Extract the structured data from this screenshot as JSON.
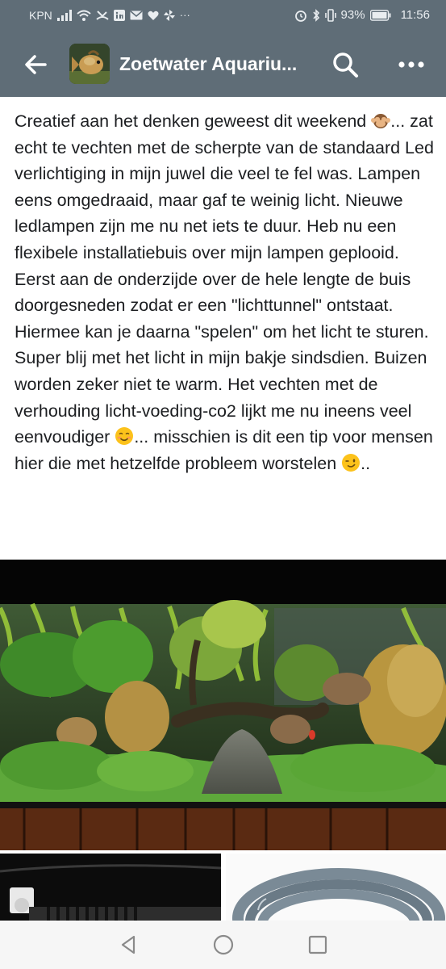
{
  "status_bar": {
    "carrier": "KPN",
    "battery": "93%",
    "time": "11:56",
    "left_icons": [
      "signal-icon",
      "wifi-icon",
      "missed-call-icon",
      "linkedin-icon",
      "mail-icon",
      "heart-icon",
      "pinwheel-icon",
      "more-notifications-icon"
    ],
    "right_icons": [
      "alarm-icon",
      "bluetooth-icon",
      "vibrate-icon",
      "battery-icon"
    ]
  },
  "app_bar": {
    "title": "Zoetwater Aquariu...",
    "bg_color": "#5f6d77",
    "icons": [
      "back-arrow-icon",
      "search-icon",
      "more-icon"
    ]
  },
  "post": {
    "paragraph1_parts": [
      "Creatief aan het denken geweest dit weekend ",
      "... zat echt te vechten met de scherpte van de standaard Led verlichtiging in mijn juwel die veel te fel was. Lampen eens omgedraaid, maar gaf te weinig licht. Nieuwe ledlampen zijn me nu net iets te duur. Heb nu een flexibele installatiebuis over mijn lampen geplooid. Eerst aan de onderzijde over de hele lengte de buis doorgesneden zodat er een \"lichttunnel\" ontstaat. Hiermee kan je daarna \"spelen\" om het licht te sturen."
    ],
    "paragraph2_parts": [
      "Super blij met het licht in mijn bakje sindsdien. Buizen worden zeker niet te warm. Het vechten met de verhouding licht-voeding-co2 lijkt me nu ineens veel eenvoudiger ",
      "... misschien is dit een tip voor mensen hier die met hetzelfde probleem worstelen ",
      ".."
    ],
    "emojis": [
      "see-no-evil-monkey-emoji",
      "smiling-face-emoji",
      "winking-face-emoji"
    ]
  },
  "photos": [
    "aquarium-photo",
    "lamp-tube-photo",
    "corrugated-tube-photo"
  ],
  "nav_bar": {
    "icons": [
      "back-triangle-icon",
      "home-circle-icon",
      "recents-square-icon"
    ]
  }
}
